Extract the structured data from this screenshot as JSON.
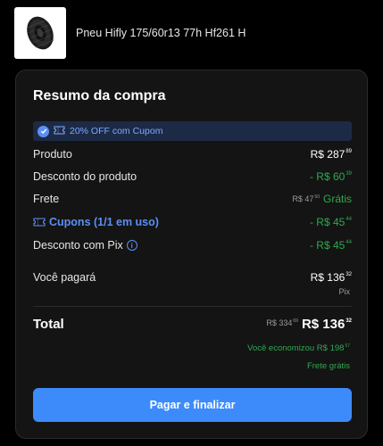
{
  "product": {
    "name": "Pneu Hifly 175/60r13 77h Hf261 H",
    "image": "tire-image"
  },
  "summary": {
    "title": "Resumo da compra",
    "promo": "20% OFF com Cupom",
    "rows": {
      "produto": {
        "label": "Produto",
        "int": "R$ 287",
        "cents": "89"
      },
      "desconto_produto": {
        "label": "Desconto do produto",
        "int": "- R$ 60",
        "cents": "39"
      },
      "frete": {
        "label": "Frete",
        "old_int": "R$ 47",
        "old_cents": "50",
        "value": "Grátis"
      },
      "cupons": {
        "label": "Cupons (1/1 em uso)",
        "int": "- R$ 45",
        "cents": "44"
      },
      "desconto_pix": {
        "label": "Desconto com Pix",
        "int": "- R$ 45",
        "cents": "44"
      },
      "voce_pagara": {
        "label": "Você pagará",
        "int": "R$ 136",
        "cents": "32",
        "method": "Pix"
      }
    },
    "total": {
      "label": "Total",
      "old_int": "R$ 334",
      "old_cents": "69",
      "int": "R$ 136",
      "cents": "32"
    },
    "savings": {
      "text": "Você economizou R$ 198",
      "cents": "57"
    },
    "shipping_note": "Frete grátis",
    "button": "Pagar e finalizar"
  },
  "colors": {
    "accent": "#3d8bfa",
    "green": "#2fa84f",
    "card": "#141414",
    "promo_bg": "#1d2a45"
  }
}
